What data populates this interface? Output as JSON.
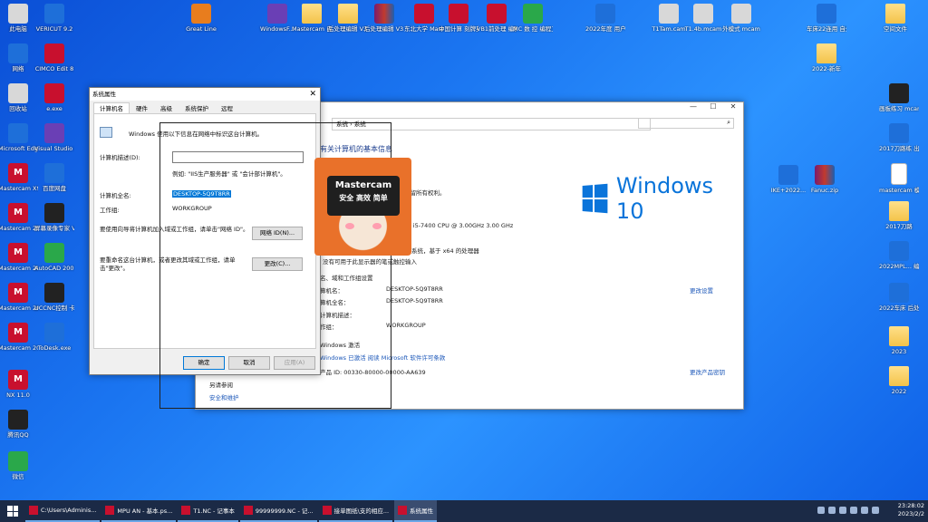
{
  "desktop": {
    "left_icons": [
      {
        "label": "此电脑",
        "cls": "gray"
      },
      {
        "label": "VERICUT 9.2",
        "cls": "blue"
      },
      {
        "label": "网络",
        "cls": "blue"
      },
      {
        "label": "CIMCO Edit 8",
        "cls": "red"
      },
      {
        "label": "回收站",
        "cls": "gray"
      },
      {
        "label": "e.exe",
        "cls": "red"
      },
      {
        "label": "Microsoft Edge",
        "cls": "blue"
      },
      {
        "label": "Visual Studio 2019",
        "cls": "purple"
      },
      {
        "label": "Mastercam X9",
        "cls": "mc"
      },
      {
        "label": "百度网盘",
        "cls": "blue"
      },
      {
        "label": "Mastercam 2017",
        "cls": "mc"
      },
      {
        "label": "屏幕录像专家 V2021",
        "cls": "dark"
      },
      {
        "label": "Mastercam 2018",
        "cls": "mc"
      },
      {
        "label": "AutoCAD 2007 - 简体",
        "cls": "green"
      },
      {
        "label": "Mastercam 2022",
        "cls": "mc"
      },
      {
        "label": "UCCNC控制 卡示例软件",
        "cls": "dark"
      },
      {
        "label": "Mastercam 2023",
        "cls": "mc"
      },
      {
        "label": "ToDesk.exe",
        "cls": "blue"
      },
      {
        "label": "NX 11.0",
        "cls": "mc"
      },
      {
        "label": "腾讯QQ",
        "cls": "dark"
      },
      {
        "label": "微信",
        "cls": "green"
      }
    ],
    "top_icons": [
      {
        "label": "Great Line",
        "cls": "orange"
      },
      {
        "label": "WindowsF...",
        "cls": "purple"
      },
      {
        "label": "Mastercam 自处理",
        "cls": "folder"
      },
      {
        "label": "后处理编辑 V3.08 正式",
        "cls": "folder"
      },
      {
        "label": "后处理编辑 V3.08 正式",
        "cls": "rar"
      },
      {
        "label": "东北大学 MasterCA...",
        "cls": "red"
      },
      {
        "label": "中国计算 刻牌英文版",
        "cls": "red"
      },
      {
        "label": "VB1前处理 编程文档",
        "cls": "red"
      },
      {
        "label": "MC 数 控 编程工具...",
        "cls": "green"
      },
      {
        "label": "2022年度 用户模板",
        "cls": "blue"
      },
      {
        "label": "T1Tam.cam",
        "cls": "gray"
      },
      {
        "label": "T1.4b.mcam",
        "cls": "gray"
      },
      {
        "label": "外模式 mcam",
        "cls": "gray"
      },
      {
        "label": "车床22连用 自处理",
        "cls": "blue"
      },
      {
        "label": "空间文件",
        "cls": "folder"
      }
    ],
    "right_icons": [
      {
        "label": "2022-新年",
        "cls": "folder"
      },
      {
        "label": "画板练习 mcam",
        "cls": "dark"
      },
      {
        "label": "2017刀路练 出自的练习...",
        "cls": "blue"
      },
      {
        "label": "mastercam 模板文件夹",
        "cls": "doc"
      },
      {
        "label": "2017刀路",
        "cls": "folder"
      },
      {
        "label": "2022MPL... 编辑程序版",
        "cls": "blue"
      },
      {
        "label": "2022车床 后处理",
        "cls": "blue"
      },
      {
        "label": "2023",
        "cls": "folder"
      },
      {
        "label": "2022",
        "cls": "folder"
      }
    ],
    "mid_icons": [
      {
        "label": "IKE+2022...",
        "cls": "blue"
      },
      {
        "label": "Fanuc.zip",
        "cls": "rar"
      }
    ]
  },
  "system_window": {
    "controls": [
      "—",
      "☐",
      "✕"
    ],
    "breadcrumb": "系统 › 系统",
    "search_icon": "⌕",
    "heading": "有关计算机的基本信息",
    "brand": "Windows 10",
    "rows": [
      "保留所有权利。",
      "Core(TM) i5-7400 CPU @ 3.00GHz   3.00 GHz",
      "系统，基于 x64 的处理器",
      "没有可用于此显示器的笔或触控输入",
      "名、域和工作组设置",
      "算机名：",
      "DESKTOP-5Q9T8RR",
      "算机全名：",
      "DESKTOP-5Q9T8RR",
      "计算机描述：",
      "作组：",
      "WORKGROUP",
      "Windows 激活",
      "Windows 已激活   阅读 Microsoft 软件许可条款",
      "产品 ID: 00330-80000-00000-AA639",
      "另请参阅",
      "安全和维护"
    ],
    "change_settings": "更改设置",
    "change_key": "更改产品密钥"
  },
  "dialog": {
    "title": "系统属性",
    "tabs": [
      "计算机名",
      "硬件",
      "高级",
      "系统保护",
      "远程"
    ],
    "intro": "Windows 使用以下信息在网络中标识这台计算机。",
    "desc_label": "计算机描述(D):",
    "desc_value": "",
    "example": "例如: \"IIS生产服务器\" 或 \"会计部计算机\"。",
    "full_name_label": "计算机全名:",
    "full_name_value": "DESKTOP-5Q9T8RR",
    "workgroup_label": "工作组:",
    "workgroup_value": "WORKGROUP",
    "network_text": "要使用向导将计算机加入域或工作组，请单击\"网络 ID\"。",
    "network_btn": "网络 ID(N)...",
    "rename_text": "要重命名这台计算机，或者更改其域或工作组，请单击\"更改\"。",
    "change_btn": "更改(C)...",
    "ok": "确定",
    "cancel": "取消",
    "apply": "应用(A)"
  },
  "sticker": {
    "text1": "Mastercam",
    "text2": "安全 高效 简单"
  },
  "taskbar": {
    "items": [
      "C:\\Users\\Adminis...",
      "MPU AN - 基本.ps...",
      "T1.NC - 记事本",
      "99999999.NC - 记...",
      "接单图纸\\支的相应...",
      "系统属性"
    ],
    "time": "23:28:02",
    "date": "2023/2/2"
  }
}
